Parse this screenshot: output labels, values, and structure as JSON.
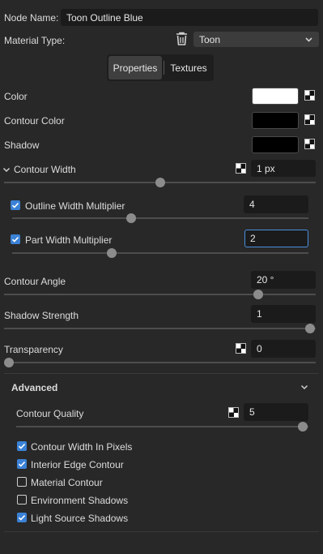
{
  "node_name": {
    "label": "Node Name:",
    "value": "Toon Outline Blue"
  },
  "material_type": {
    "label": "Material Type:",
    "value": "Toon"
  },
  "tabs": [
    {
      "label": "Properties",
      "active": true
    },
    {
      "label": "Textures",
      "active": false
    }
  ],
  "color": {
    "label": "Color",
    "value": "#ffffff"
  },
  "contour_color": {
    "label": "Contour Color",
    "value": "#000000"
  },
  "shadow": {
    "label": "Shadow",
    "value": "#000000"
  },
  "contour_width": {
    "label": "Contour Width",
    "value": "1 px",
    "level": 0.5
  },
  "outline_width_multiplier": {
    "label": "Outline Width Multiplier",
    "value": "4",
    "checked": true,
    "level": 0.4
  },
  "part_width_multiplier": {
    "label": "Part Width Multiplier",
    "value": "2",
    "checked": true,
    "level": 0.36
  },
  "contour_angle": {
    "label": "Contour Angle",
    "value": "20 °",
    "level": 0.83
  },
  "shadow_strength": {
    "label": "Shadow Strength",
    "value": "1",
    "level": 1.0
  },
  "transparency": {
    "label": "Transparency",
    "value": "0",
    "level": 0.0
  },
  "advanced": {
    "title": "Advanced",
    "contour_quality": {
      "label": "Contour Quality",
      "value": "5",
      "level": 1.0
    },
    "checkboxes": [
      {
        "label": "Contour Width In Pixels",
        "checked": true
      },
      {
        "label": "Interior Edge Contour",
        "checked": true
      },
      {
        "label": "Material Contour",
        "checked": false
      },
      {
        "label": "Environment Shadows",
        "checked": false
      },
      {
        "label": "Light Source Shadows",
        "checked": true
      }
    ]
  },
  "colors": {
    "accent": "#3b82d6",
    "panel": "#282828",
    "field": "#1b1b1b"
  }
}
